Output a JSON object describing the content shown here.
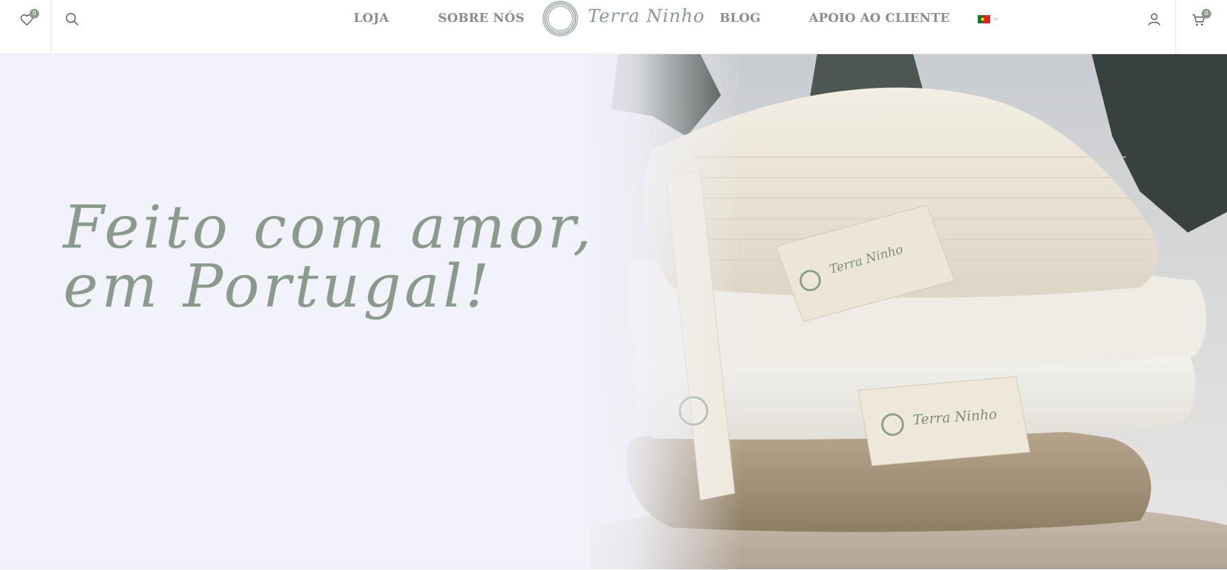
{
  "header": {
    "wishlist_count": "0",
    "cart_count": "0",
    "nav": {
      "shop": "LOJA",
      "about": "SOBRE NÓS",
      "blog": "BLOG",
      "support": "APOIO AO CLIENTE"
    },
    "logo_text": "Terra Ninho",
    "language_flag": "flag-portugal-icon"
  },
  "hero": {
    "headline_line1": "Feito com amor,",
    "headline_line2": "em Portugal!",
    "label_text_1": "Terra Ninho",
    "label_text_2": "Terra Ninho"
  },
  "colors": {
    "brand_sage": "#8a9b8d",
    "nav_gray": "#8c8c8c",
    "hero_background": "#f1f2fa"
  }
}
